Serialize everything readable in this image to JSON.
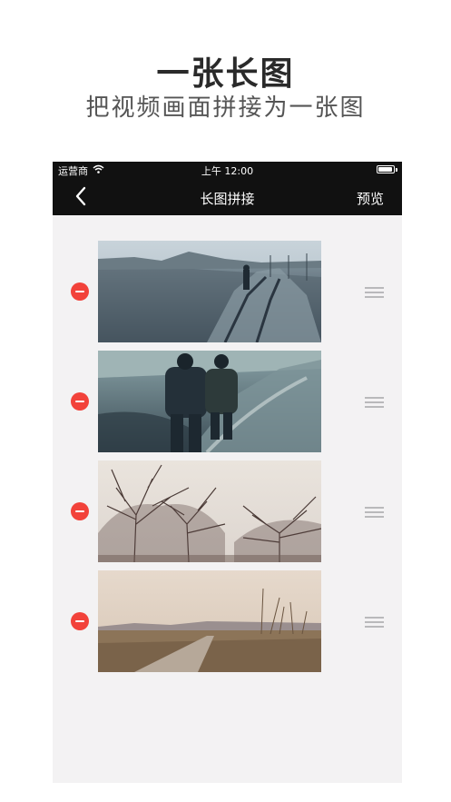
{
  "promo": {
    "title": "一张长图",
    "subtitle": "把视频画面拼接为一张图"
  },
  "status_bar": {
    "carrier": "运营商",
    "time": "上午 12:00",
    "wifi_icon": "wifi-icon",
    "battery_icon": "battery-icon"
  },
  "nav": {
    "back_icon": "chevron-left-icon",
    "title": "长图拼接",
    "preview_label": "预览"
  },
  "colors": {
    "nav_background": "#111111",
    "screen_background": "#f3f2f3",
    "delete_red": "#f2423a",
    "drag_handle": "#b9b9bb"
  },
  "frames": [
    {
      "scene": "muddy-road-person-walking",
      "delete_icon": "minus-circle-icon",
      "handle_icon": "drag-handle-icon"
    },
    {
      "scene": "two-people-walking-mud",
      "delete_icon": "minus-circle-icon",
      "handle_icon": "drag-handle-icon"
    },
    {
      "scene": "bare-trees-pale-sky",
      "delete_icon": "minus-circle-icon",
      "handle_icon": "drag-handle-icon"
    },
    {
      "scene": "dirt-road-dry-field",
      "delete_icon": "minus-circle-icon",
      "handle_icon": "drag-handle-icon"
    }
  ]
}
